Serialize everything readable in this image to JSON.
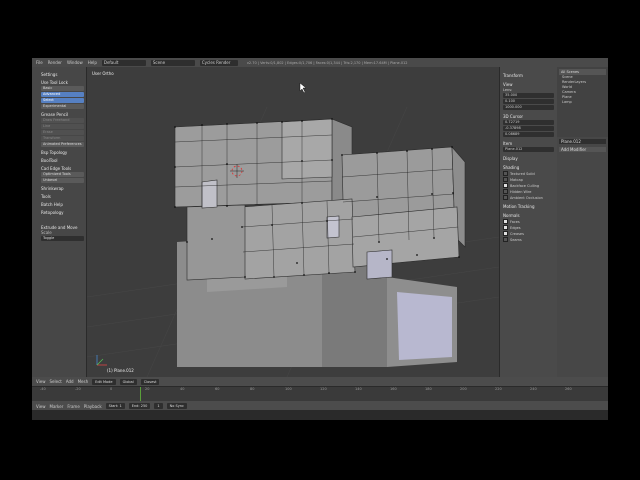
{
  "topbar": {
    "menus": [
      "File",
      "Render",
      "Window",
      "Help"
    ],
    "screen": "Default",
    "scene": "Scene",
    "engine": "Cycles Render",
    "stats": "v2.70 | Verts:0/1,802 | Edges:0/1,706 | Faces:0/1,344 | Tris:2,170 | Mem:17.64M | Plane.012"
  },
  "toolshelf": {
    "items": [
      {
        "label": "Settings",
        "state": "header"
      },
      {
        "label": "Use Tool Lock",
        "state": "header"
      },
      {
        "label": "Basic",
        "state": "normal"
      },
      {
        "label": "Advanced",
        "state": "active"
      },
      {
        "label": "Select",
        "state": "active"
      },
      {
        "label": "Experimental",
        "state": "normal"
      },
      {
        "label": "Grease Pencil",
        "state": "header"
      },
      {
        "label": "Draw Freehand",
        "state": "dim"
      },
      {
        "label": "Line",
        "state": "dim"
      },
      {
        "label": "Erase",
        "state": "dim"
      },
      {
        "label": "Transform",
        "state": "dim"
      },
      {
        "label": "Animated Preferences",
        "state": "normal"
      },
      {
        "label": "Bsp Topology",
        "state": "header"
      },
      {
        "label": "BoolTool",
        "state": "header"
      },
      {
        "label": "Cad Edge Tools",
        "state": "header"
      },
      {
        "label": "Optimized Tools",
        "state": "normal"
      },
      {
        "label": "Unbevel",
        "state": "normal"
      },
      {
        "label": "Shrinkwrap",
        "state": "header"
      },
      {
        "label": "Tools",
        "state": "header"
      },
      {
        "label": "Batch Help",
        "state": "header"
      },
      {
        "label": "Retopology",
        "state": "header"
      }
    ],
    "operator_panel": "Extrude and Move",
    "operator_field_label": "Scale",
    "operator_field_value": "Toggle"
  },
  "viewport": {
    "title": "User Ortho",
    "object_label": "(1) Plane.012"
  },
  "properties_panel": {
    "sections": [
      "Transform",
      "View",
      "3D Cursor",
      "Item",
      "Display",
      "Shading",
      "Motion Tracking",
      "Normals"
    ],
    "view_lens_label": "Lens:",
    "view_lens_value": "35.000",
    "clip_start": "0.100",
    "clip_end": "1000.000",
    "cursor_x": "0.72719",
    "cursor_y": "-0.37898",
    "cursor_z": "0.08689",
    "item_name": "Plane.012",
    "shading_checks": [
      {
        "label": "Textured Solid",
        "checked": false
      },
      {
        "label": "Matcap",
        "checked": false
      },
      {
        "label": "Backface Culling",
        "checked": true
      },
      {
        "label": "Hidden Wire",
        "checked": false
      },
      {
        "label": "Ambient Occlusion",
        "checked": false
      }
    ],
    "overlay_checks": [
      {
        "label": "Faces",
        "checked": true
      },
      {
        "label": "Edges",
        "checked": true
      },
      {
        "label": "Creases",
        "checked": true
      },
      {
        "label": "Seams",
        "checked": false
      }
    ]
  },
  "outliner": {
    "header": "All Scenes",
    "items": [
      "Scene",
      "RenderLayers",
      "World",
      "Camera",
      "Plane",
      "Lamp"
    ],
    "properties_item": "Plane.012",
    "modifier_label": "Add Modifier"
  },
  "viewport_header": {
    "menus": [
      "View",
      "Select",
      "Add",
      "Mesh"
    ],
    "mode": "Edit Mode",
    "pivot": "Global",
    "snap": "Closest"
  },
  "timeline": {
    "menus": [
      "View",
      "Marker",
      "Frame",
      "Playback"
    ],
    "start_label": "Start:",
    "start": "1",
    "end_label": "End:",
    "end": "250",
    "current": "1",
    "sync": "No Sync",
    "ticks": [
      "-40",
      "-20",
      "0",
      "20",
      "40",
      "60",
      "80",
      "100",
      "120",
      "140",
      "160",
      "180",
      "200",
      "220",
      "240",
      "260"
    ]
  },
  "colors": {
    "accent": "#5680c2",
    "vertex": "#111111"
  }
}
